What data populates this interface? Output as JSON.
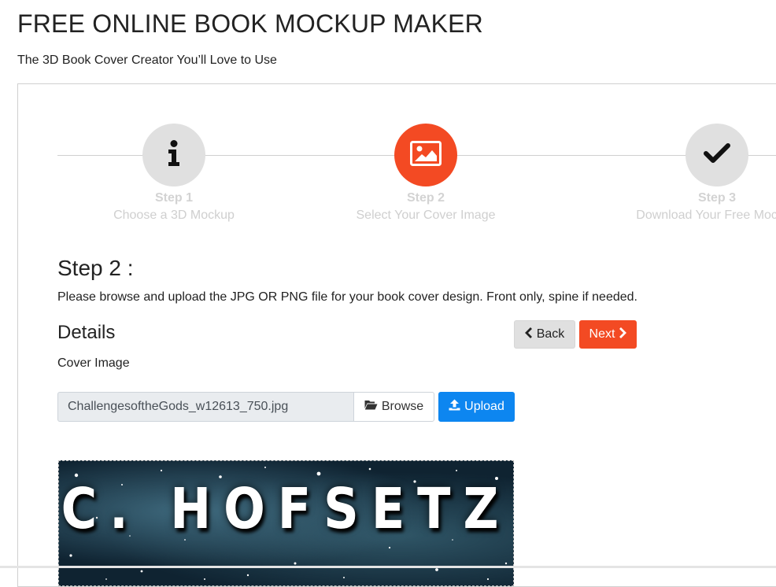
{
  "header": {
    "title": "FREE ONLINE BOOK MOCKUP MAKER",
    "subtitle": "The 3D Book Cover Creator You’ll Love to Use"
  },
  "stepper": {
    "steps": [
      {
        "number": "Step 1",
        "label": "Choose a 3D Mockup",
        "icon": "info-icon",
        "active": false
      },
      {
        "number": "Step 2",
        "label": "Select Your Cover Image",
        "icon": "image-icon",
        "active": true
      },
      {
        "number": "Step 3",
        "label": "Download Your Free Mockup",
        "icon": "checkmark-icon",
        "active": false
      }
    ],
    "active_color": "#f34a23",
    "inactive_color": "#e0e0e0"
  },
  "main": {
    "heading": "Step 2 :",
    "instructions": "Please browse and upload the JPG OR PNG file for your book cover design. Front only, spine if needed.",
    "details_heading": "Details",
    "back_label": "Back",
    "next_label": "Next",
    "cover_label": "Cover Image",
    "file_value": "ChallengesoftheGods_w12613_750.jpg",
    "browse_label": "Browse",
    "upload_label": "Upload"
  },
  "preview": {
    "author_text": "C. HOFSETZ"
  },
  "colors": {
    "accent": "#f34a23",
    "upload_blue": "#0d86f0"
  }
}
